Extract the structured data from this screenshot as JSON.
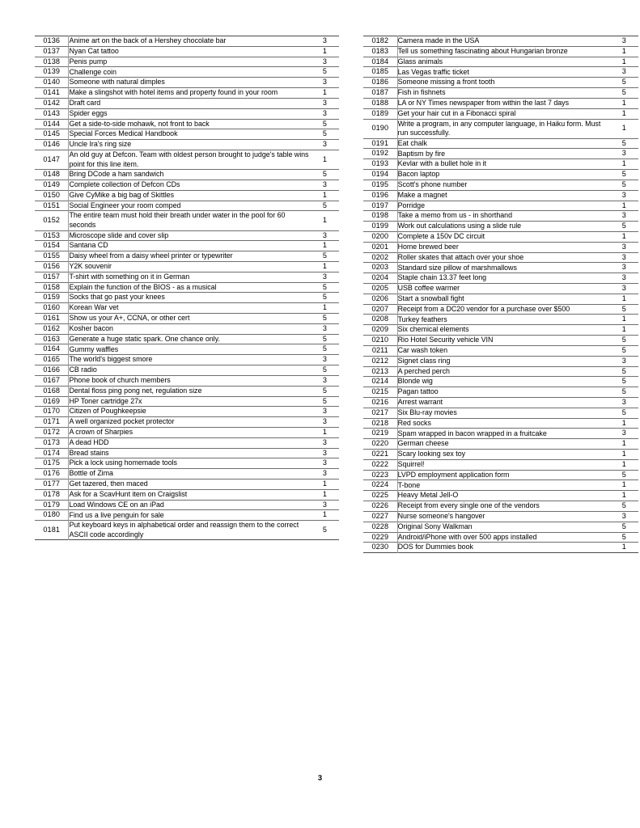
{
  "document": {
    "page_number": "3",
    "columns": [
      {
        "id": "left-column",
        "rows": [
          {
            "id": "0136",
            "desc": "Anime art on the back of a Hershey chocolate bar",
            "pts": "3"
          },
          {
            "id": "0137",
            "desc": "Nyan Cat tattoo",
            "pts": "1"
          },
          {
            "id": "0138",
            "desc": "Penis pump",
            "pts": "3"
          },
          {
            "id": "0139",
            "desc": "Challenge coin",
            "pts": "5"
          },
          {
            "id": "0140",
            "desc": "Someone with natural dimples",
            "pts": "3"
          },
          {
            "id": "0141",
            "desc": "Make a slingshot with hotel items and property found in your room",
            "pts": "1"
          },
          {
            "id": "0142",
            "desc": "Draft card",
            "pts": "3"
          },
          {
            "id": "0143",
            "desc": "Spider eggs",
            "pts": "3"
          },
          {
            "id": "0144",
            "desc": "Get a side-to-side mohawk, not front to back",
            "pts": "5"
          },
          {
            "id": "0145",
            "desc": "Special Forces Medical Handbook",
            "pts": "5"
          },
          {
            "id": "0146",
            "desc": "Uncle Ira's ring size",
            "pts": "3"
          },
          {
            "id": "0147",
            "desc": "An old guy at Defcon. Team with oldest person brought to judge's table wins point for this line item.",
            "pts": "1"
          },
          {
            "id": "0148",
            "desc": "Bring DCode a ham sandwich",
            "pts": "5"
          },
          {
            "id": "0149",
            "desc": "Complete collection of Defcon CDs",
            "pts": "3"
          },
          {
            "id": "0150",
            "desc": "Give CyMike a big bag of Skittles",
            "pts": "1"
          },
          {
            "id": "0151",
            "desc": "Social Engineer your room comped",
            "pts": "5"
          },
          {
            "id": "0152",
            "desc": "The entire team must hold their breath under water in the pool for 60 seconds",
            "pts": "1"
          },
          {
            "id": "0153",
            "desc": "Microscope slide and cover slip",
            "pts": "3"
          },
          {
            "id": "0154",
            "desc": "Santana CD",
            "pts": "1"
          },
          {
            "id": "0155",
            "desc": "Daisy wheel from a daisy wheel printer or typewriter",
            "pts": "5"
          },
          {
            "id": "0156",
            "desc": "Y2K souvenir",
            "pts": "1"
          },
          {
            "id": "0157",
            "desc": "T-shirt with something on it in German",
            "pts": "3"
          },
          {
            "id": "0158",
            "desc": "Explain the function of the BIOS - as a musical",
            "pts": "5"
          },
          {
            "id": "0159",
            "desc": "Socks that go past your knees",
            "pts": "5"
          },
          {
            "id": "0160",
            "desc": "Korean War vet",
            "pts": "1"
          },
          {
            "id": "0161",
            "desc": "Show us your A+, CCNA, or other cert",
            "pts": "5"
          },
          {
            "id": "0162",
            "desc": "Kosher bacon",
            "pts": "3"
          },
          {
            "id": "0163",
            "desc": "Generate a huge static spark. One chance only.",
            "pts": "5"
          },
          {
            "id": "0164",
            "desc": "Gummy waffles",
            "pts": "5"
          },
          {
            "id": "0165",
            "desc": "The world's biggest smore",
            "pts": "3"
          },
          {
            "id": "0166",
            "desc": "CB radio",
            "pts": "5"
          },
          {
            "id": "0167",
            "desc": "Phone book of church members",
            "pts": "3"
          },
          {
            "id": "0168",
            "desc": "Dental floss ping pong net, regulation size",
            "pts": "5"
          },
          {
            "id": "0169",
            "desc": "HP Toner cartridge 27x",
            "pts": "5"
          },
          {
            "id": "0170",
            "desc": "Citizen of Poughkeepsie",
            "pts": "3"
          },
          {
            "id": "0171",
            "desc": "A well organized pocket protector",
            "pts": "3"
          },
          {
            "id": "0172",
            "desc": "A crown of Sharpies",
            "pts": "1"
          },
          {
            "id": "0173",
            "desc": "A dead HDD",
            "pts": "3"
          },
          {
            "id": "0174",
            "desc": "Bread stains",
            "pts": "3"
          },
          {
            "id": "0175",
            "desc": "Pick a lock using homemade tools",
            "pts": "3"
          },
          {
            "id": "0176",
            "desc": "Bottle of Zima",
            "pts": "3"
          },
          {
            "id": "0177",
            "desc": "Get tazered, then maced",
            "pts": "1"
          },
          {
            "id": "0178",
            "desc": "Ask for a ScavHunt item on Craigslist",
            "pts": "1"
          },
          {
            "id": "0179",
            "desc": "Load Windows CE on an iPad",
            "pts": "3"
          },
          {
            "id": "0180",
            "desc": "Find us a live penguin for sale",
            "pts": "1"
          },
          {
            "id": "0181",
            "desc": "Put keyboard keys in alphabetical order and reassign them to the correct ASCII code accordingly",
            "pts": "5"
          }
        ]
      },
      {
        "id": "right-column",
        "rows": [
          {
            "id": "0182",
            "desc": "Camera made in the USA",
            "pts": "3"
          },
          {
            "id": "0183",
            "desc": "Tell us something fascinating about Hungarian bronze",
            "pts": "1"
          },
          {
            "id": "0184",
            "desc": "Glass animals",
            "pts": "1"
          },
          {
            "id": "0185",
            "desc": "Las Vegas traffic ticket",
            "pts": "3"
          },
          {
            "id": "0186",
            "desc": "Someone missing a front tooth",
            "pts": "5"
          },
          {
            "id": "0187",
            "desc": "Fish in fishnets",
            "pts": "5"
          },
          {
            "id": "0188",
            "desc": "LA or NY Times newspaper from within the last 7 days",
            "pts": "1"
          },
          {
            "id": "0189",
            "desc": "Get your hair cut in a Fibonacci spiral",
            "pts": "1"
          },
          {
            "id": "0190",
            "desc": "Write a program, in any computer language, in Haiku form. Must run successfully.",
            "pts": "1"
          },
          {
            "id": "0191",
            "desc": "Eat chalk",
            "pts": "5"
          },
          {
            "id": "0192",
            "desc": "Baptism by fire",
            "pts": "3"
          },
          {
            "id": "0193",
            "desc": "Kevlar with a bullet hole in it",
            "pts": "1"
          },
          {
            "id": "0194",
            "desc": "Bacon laptop",
            "pts": "5"
          },
          {
            "id": "0195",
            "desc": "Scott's phone number",
            "pts": "5"
          },
          {
            "id": "0196",
            "desc": "Make a magnet",
            "pts": "3"
          },
          {
            "id": "0197",
            "desc": "Porridge",
            "pts": "1"
          },
          {
            "id": "0198",
            "desc": "Take a memo from us - in shorthand",
            "pts": "3"
          },
          {
            "id": "0199",
            "desc": "Work out calculations using a slide rule",
            "pts": "5"
          },
          {
            "id": "0200",
            "desc": "Complete a 150v DC circuit",
            "pts": "1"
          },
          {
            "id": "0201",
            "desc": "Home brewed beer",
            "pts": "3"
          },
          {
            "id": "0202",
            "desc": "Roller skates that attach over your shoe",
            "pts": "3"
          },
          {
            "id": "0203",
            "desc": "Standard size pillow of marshmallows",
            "pts": "3"
          },
          {
            "id": "0204",
            "desc": "Staple chain 13.37 feet long",
            "pts": "3"
          },
          {
            "id": "0205",
            "desc": "USB coffee warmer",
            "pts": "3"
          },
          {
            "id": "0206",
            "desc": "Start a snowball fight",
            "pts": "1"
          },
          {
            "id": "0207",
            "desc": "Receipt from a DC20 vendor for a purchase over $500",
            "pts": "5"
          },
          {
            "id": "0208",
            "desc": "Turkey feathers",
            "pts": "1"
          },
          {
            "id": "0209",
            "desc": "Six chemical elements",
            "pts": "1"
          },
          {
            "id": "0210",
            "desc": "Rio Hotel Security vehicle VIN",
            "pts": "5"
          },
          {
            "id": "0211",
            "desc": "Car wash token",
            "pts": "5"
          },
          {
            "id": "0212",
            "desc": "Signet class ring",
            "pts": "3"
          },
          {
            "id": "0213",
            "desc": "A perched perch",
            "pts": "5"
          },
          {
            "id": "0214",
            "desc": "Blonde wig",
            "pts": "5"
          },
          {
            "id": "0215",
            "desc": "Pagan tattoo",
            "pts": "5"
          },
          {
            "id": "0216",
            "desc": "Arrest warrant",
            "pts": "3"
          },
          {
            "id": "0217",
            "desc": "Six Blu-ray movies",
            "pts": "5"
          },
          {
            "id": "0218",
            "desc": "Red socks",
            "pts": "1"
          },
          {
            "id": "0219",
            "desc": "Spam wrapped in bacon wrapped in a fruitcake",
            "pts": "3"
          },
          {
            "id": "0220",
            "desc": "German cheese",
            "pts": "1"
          },
          {
            "id": "0221",
            "desc": "Scary looking sex toy",
            "pts": "1"
          },
          {
            "id": "0222",
            "desc": "Squirrel!",
            "pts": "1"
          },
          {
            "id": "0223",
            "desc": "LVPD employment application form",
            "pts": "5"
          },
          {
            "id": "0224",
            "desc": "T-bone",
            "pts": "1"
          },
          {
            "id": "0225",
            "desc": "Heavy Metal Jell-O",
            "pts": "1"
          },
          {
            "id": "0226",
            "desc": "Receipt from every single one of the vendors",
            "pts": "5"
          },
          {
            "id": "0227",
            "desc": "Nurse someone's hangover",
            "pts": "3"
          },
          {
            "id": "0228",
            "desc": "Original Sony Walkman",
            "pts": "5"
          },
          {
            "id": "0229",
            "desc": "Android/iPhone with over 500 apps installed",
            "pts": "5"
          },
          {
            "id": "0230",
            "desc": "DOS for Dummies book",
            "pts": "1"
          }
        ]
      }
    ]
  }
}
